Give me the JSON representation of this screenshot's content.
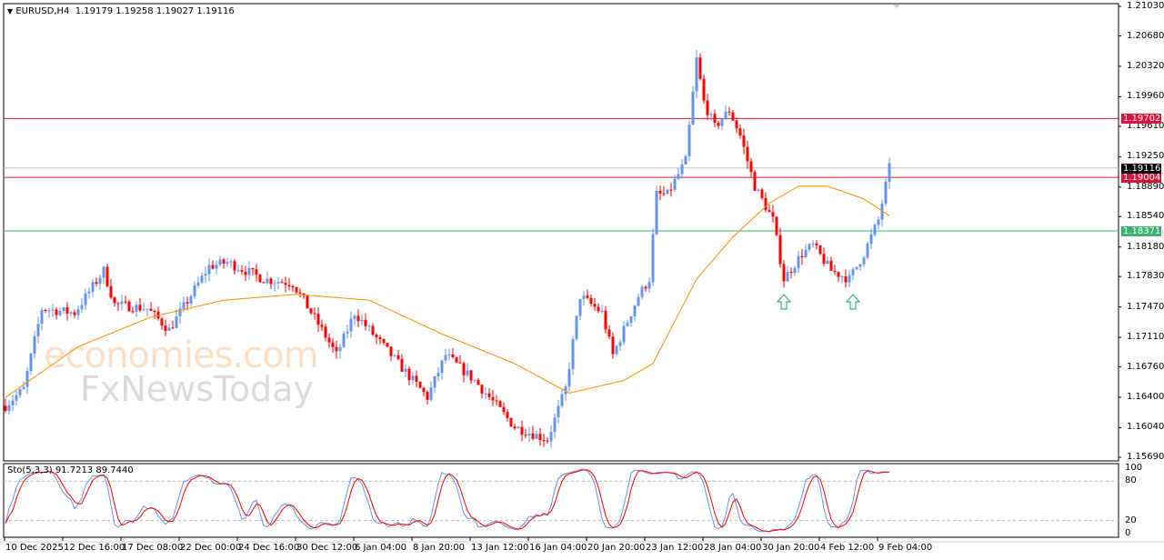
{
  "header": {
    "symbol": "EURUSD,H4",
    "open": "1.19179",
    "high": "1.19258",
    "low": "1.19027",
    "close": "1.19116"
  },
  "indicator": {
    "label": "Sto(5,3,3) 91.7213 89.7440",
    "levels": [
      "100",
      "80",
      "20",
      "0"
    ]
  },
  "price_axis": [
    "1.21030",
    "1.20680",
    "1.20320",
    "1.19960",
    "1.19610",
    "1.19250",
    "1.18890",
    "1.18540",
    "1.18180",
    "1.17830",
    "1.17470",
    "1.17110",
    "1.16760",
    "1.16400",
    "1.16040",
    "1.15690"
  ],
  "hlines": [
    {
      "label": "1.19702",
      "value": 1.19702,
      "color": "#dc143c"
    },
    {
      "label": "1.19004",
      "value": 1.19004,
      "color": "#dc143c"
    },
    {
      "label": "1.18371",
      "value": 1.18371,
      "color": "#3cb371"
    },
    {
      "label": "1.19116",
      "value": 1.19116,
      "color": "#000000",
      "line": "#c0c0c0"
    }
  ],
  "time_axis": [
    "10 Dec 2025",
    "12 Dec 16:00",
    "17 Dec 08:00",
    "22 Dec 00:00",
    "24 Dec 16:00",
    "30 Dec 12:00",
    "6 Jan 04:00",
    "8 Jan 20:00",
    "13 Jan 12:00",
    "16 Jan 04:00",
    "20 Jan 20:00",
    "23 Jan 12:00",
    "28 Jan 04:00",
    "30 Jan 20:00",
    "4 Feb 12:00",
    "9 Feb 04:00"
  ],
  "watermark": {
    "line1": "economies.com",
    "line2": "FxNewsToday"
  },
  "colors": {
    "bull": "#6495ed",
    "bear": "#ff0000",
    "ma": "#ff8c00",
    "stoch_main": "#6495ed",
    "stoch_signal": "#ff0000",
    "arrow": "#3cb371"
  },
  "chart_data": {
    "type": "candlestick",
    "symbol": "EURUSD",
    "timeframe": "H4",
    "ylim": [
      1.1569,
      1.2103
    ],
    "price_path": [
      [
        0,
        1.163
      ],
      [
        5,
        1.165
      ],
      [
        10,
        1.1745
      ],
      [
        19,
        1.174
      ],
      [
        27,
        1.179
      ],
      [
        30,
        1.175
      ],
      [
        39,
        1.1745
      ],
      [
        45,
        1.172
      ],
      [
        56,
        1.1795
      ],
      [
        61,
        1.18
      ],
      [
        71,
        1.178
      ],
      [
        79,
        1.1775
      ],
      [
        87,
        1.172
      ],
      [
        91,
        1.169
      ],
      [
        96,
        1.174
      ],
      [
        104,
        1.17
      ],
      [
        116,
        1.164
      ],
      [
        121,
        1.169
      ],
      [
        129,
        1.166
      ],
      [
        140,
        1.1605
      ],
      [
        149,
        1.159
      ],
      [
        154,
        1.165
      ],
      [
        158,
        1.176
      ],
      [
        164,
        1.174
      ],
      [
        167,
        1.169
      ],
      [
        174,
        1.176
      ],
      [
        177,
        1.178
      ],
      [
        179,
        1.188
      ],
      [
        182,
        1.188
      ],
      [
        187,
        1.192
      ],
      [
        190,
        1.204
      ],
      [
        192,
        1.199
      ],
      [
        195,
        1.196
      ],
      [
        199,
        1.198
      ],
      [
        202,
        1.195
      ],
      [
        206,
        1.189
      ],
      [
        211,
        1.185
      ],
      [
        214,
        1.178
      ],
      [
        219,
        1.181
      ],
      [
        222,
        1.182
      ],
      [
        227,
        1.179
      ],
      [
        232,
        1.178
      ],
      [
        236,
        1.181
      ],
      [
        240,
        1.185
      ],
      [
        243,
        1.19116
      ]
    ],
    "ma_path": [
      [
        0,
        1.164
      ],
      [
        20,
        1.17
      ],
      [
        40,
        1.1735
      ],
      [
        60,
        1.1755
      ],
      [
        80,
        1.1762
      ],
      [
        100,
        1.1755
      ],
      [
        120,
        1.1715
      ],
      [
        140,
        1.168
      ],
      [
        155,
        1.1645
      ],
      [
        170,
        1.166
      ],
      [
        178,
        1.168
      ],
      [
        190,
        1.178
      ],
      [
        200,
        1.183
      ],
      [
        210,
        1.187
      ],
      [
        218,
        1.189
      ],
      [
        226,
        1.189
      ],
      [
        236,
        1.1875
      ],
      [
        243,
        1.1855
      ]
    ],
    "arrows": [
      {
        "index": 214,
        "direction": "up"
      },
      {
        "index": 233,
        "direction": "up"
      }
    ],
    "stochastic": {
      "k": 5,
      "d": 3,
      "slowing": 3,
      "last_main": 91.7213,
      "last_signal": 89.744
    }
  }
}
